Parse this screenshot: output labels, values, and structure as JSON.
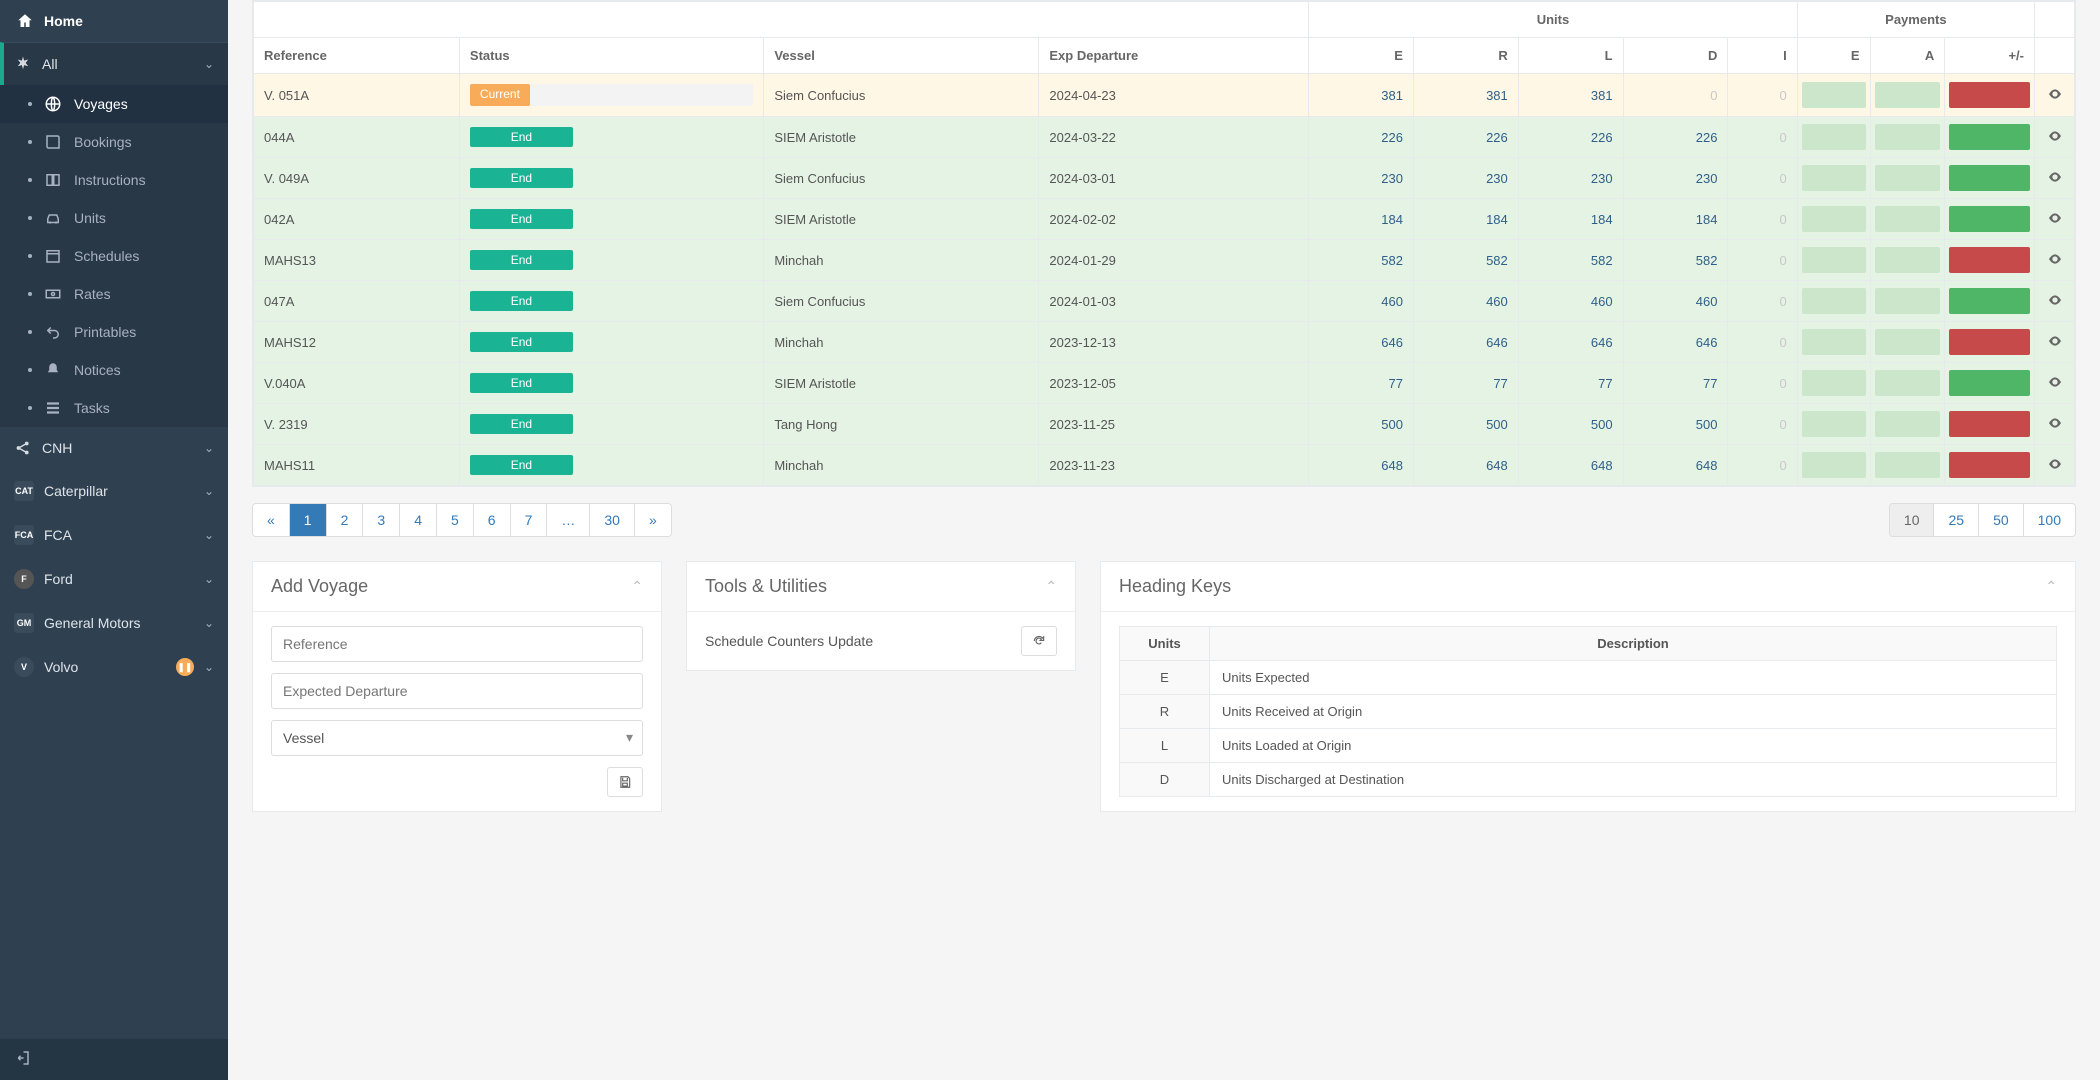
{
  "sidebar": {
    "home": "Home",
    "all_label": "All",
    "sub": {
      "voyages": "Voyages",
      "bookings": "Bookings",
      "instructions": "Instructions",
      "units": "Units",
      "schedules": "Schedules",
      "rates": "Rates",
      "printables": "Printables",
      "notices": "Notices",
      "tasks": "Tasks"
    },
    "brands": {
      "cnh": "CNH",
      "cat": "Caterpillar",
      "fca": "FCA",
      "ford": "Ford",
      "gm": "General Motors",
      "volvo": "Volvo"
    }
  },
  "table": {
    "group_units": "Units",
    "group_payments": "Payments",
    "headers": {
      "ref": "Reference",
      "status": "Status",
      "vessel": "Vessel",
      "exp": "Exp Departure",
      "uE": "E",
      "uR": "R",
      "uL": "L",
      "uD": "D",
      "uI": "I",
      "pE": "E",
      "pA": "A",
      "pPM": "+/-"
    },
    "status_labels": {
      "current": "Current",
      "end": "End"
    },
    "rows": [
      {
        "ref": "V. 051A",
        "status": "current",
        "vessel": "Siem Confucius",
        "exp": "2024-04-23",
        "e": "381",
        "r": "381",
        "l": "381",
        "d": "0",
        "i": "0",
        "pm": "red"
      },
      {
        "ref": "044A",
        "status": "end",
        "vessel": "SIEM Aristotle",
        "exp": "2024-03-22",
        "e": "226",
        "r": "226",
        "l": "226",
        "d": "226",
        "i": "0",
        "pm": "green"
      },
      {
        "ref": "V. 049A",
        "status": "end",
        "vessel": "Siem Confucius",
        "exp": "2024-03-01",
        "e": "230",
        "r": "230",
        "l": "230",
        "d": "230",
        "i": "0",
        "pm": "green"
      },
      {
        "ref": "042A",
        "status": "end",
        "vessel": "SIEM Aristotle",
        "exp": "2024-02-02",
        "e": "184",
        "r": "184",
        "l": "184",
        "d": "184",
        "i": "0",
        "pm": "green"
      },
      {
        "ref": "MAHS13",
        "status": "end",
        "vessel": "Minchah",
        "exp": "2024-01-29",
        "e": "582",
        "r": "582",
        "l": "582",
        "d": "582",
        "i": "0",
        "pm": "red"
      },
      {
        "ref": "047A",
        "status": "end",
        "vessel": "Siem Confucius",
        "exp": "2024-01-03",
        "e": "460",
        "r": "460",
        "l": "460",
        "d": "460",
        "i": "0",
        "pm": "green"
      },
      {
        "ref": "MAHS12",
        "status": "end",
        "vessel": "Minchah",
        "exp": "2023-12-13",
        "e": "646",
        "r": "646",
        "l": "646",
        "d": "646",
        "i": "0",
        "pm": "red"
      },
      {
        "ref": "V.040A",
        "status": "end",
        "vessel": "SIEM Aristotle",
        "exp": "2023-12-05",
        "e": "77",
        "r": "77",
        "l": "77",
        "d": "77",
        "i": "0",
        "pm": "green"
      },
      {
        "ref": "V. 2319",
        "status": "end",
        "vessel": "Tang Hong",
        "exp": "2023-11-25",
        "e": "500",
        "r": "500",
        "l": "500",
        "d": "500",
        "i": "0",
        "pm": "red"
      },
      {
        "ref": "MAHS11",
        "status": "end",
        "vessel": "Minchah",
        "exp": "2023-11-23",
        "e": "648",
        "r": "648",
        "l": "648",
        "d": "648",
        "i": "0",
        "pm": "red"
      }
    ]
  },
  "pager": {
    "prev": "«",
    "next": "»",
    "ellipsis": "…",
    "pages": [
      "1",
      "2",
      "3",
      "4",
      "5",
      "6",
      "7"
    ],
    "last": "30",
    "sizes": [
      "10",
      "25",
      "50",
      "100"
    ]
  },
  "panels": {
    "add": {
      "title": "Add Voyage",
      "ref_ph": "Reference",
      "exp_ph": "Expected Departure",
      "vessel": "Vessel"
    },
    "tools": {
      "title": "Tools & Utilities",
      "row1": "Schedule Counters Update"
    },
    "keys": {
      "title": "Heading Keys",
      "th_units": "Units",
      "th_desc": "Description",
      "rows": [
        {
          "k": "E",
          "d": "Units Expected"
        },
        {
          "k": "R",
          "d": "Units Received at Origin"
        },
        {
          "k": "L",
          "d": "Units Loaded at Origin"
        },
        {
          "k": "D",
          "d": "Units Discharged at Destination"
        }
      ]
    }
  }
}
